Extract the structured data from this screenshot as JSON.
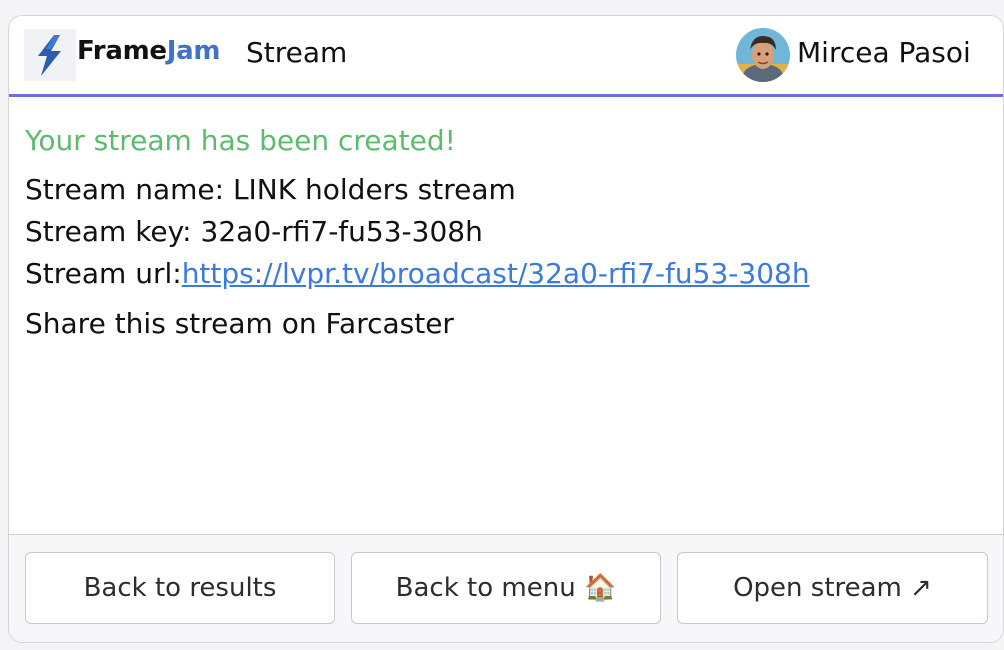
{
  "header": {
    "brand_frame": "Frame",
    "brand_jam": "Jam",
    "brand_sub": "Stream",
    "user_name": "Mircea Pasoi",
    "accent_color": "#6b6fe0"
  },
  "content": {
    "success_message": "Your stream has been created!",
    "stream_name_label": "Stream name: ",
    "stream_name": "LINK holders stream",
    "stream_key_label": "Stream key: ",
    "stream_key": "32a0-rfi7-fu53-308h",
    "stream_url_label": "Stream url:",
    "stream_url": "https://lvpr.tv/broadcast/32a0-rfi7-fu53-308h ",
    "share_text": "Share this stream on Farcaster",
    "success_color": "#5dbb6d",
    "link_color": "#3b7be0"
  },
  "buttons": [
    {
      "label": "Back to results",
      "icon": ""
    },
    {
      "label": "Back to menu 🏠",
      "icon": "house-icon"
    },
    {
      "label": "Open stream ↗",
      "icon": "external-link-icon"
    }
  ]
}
